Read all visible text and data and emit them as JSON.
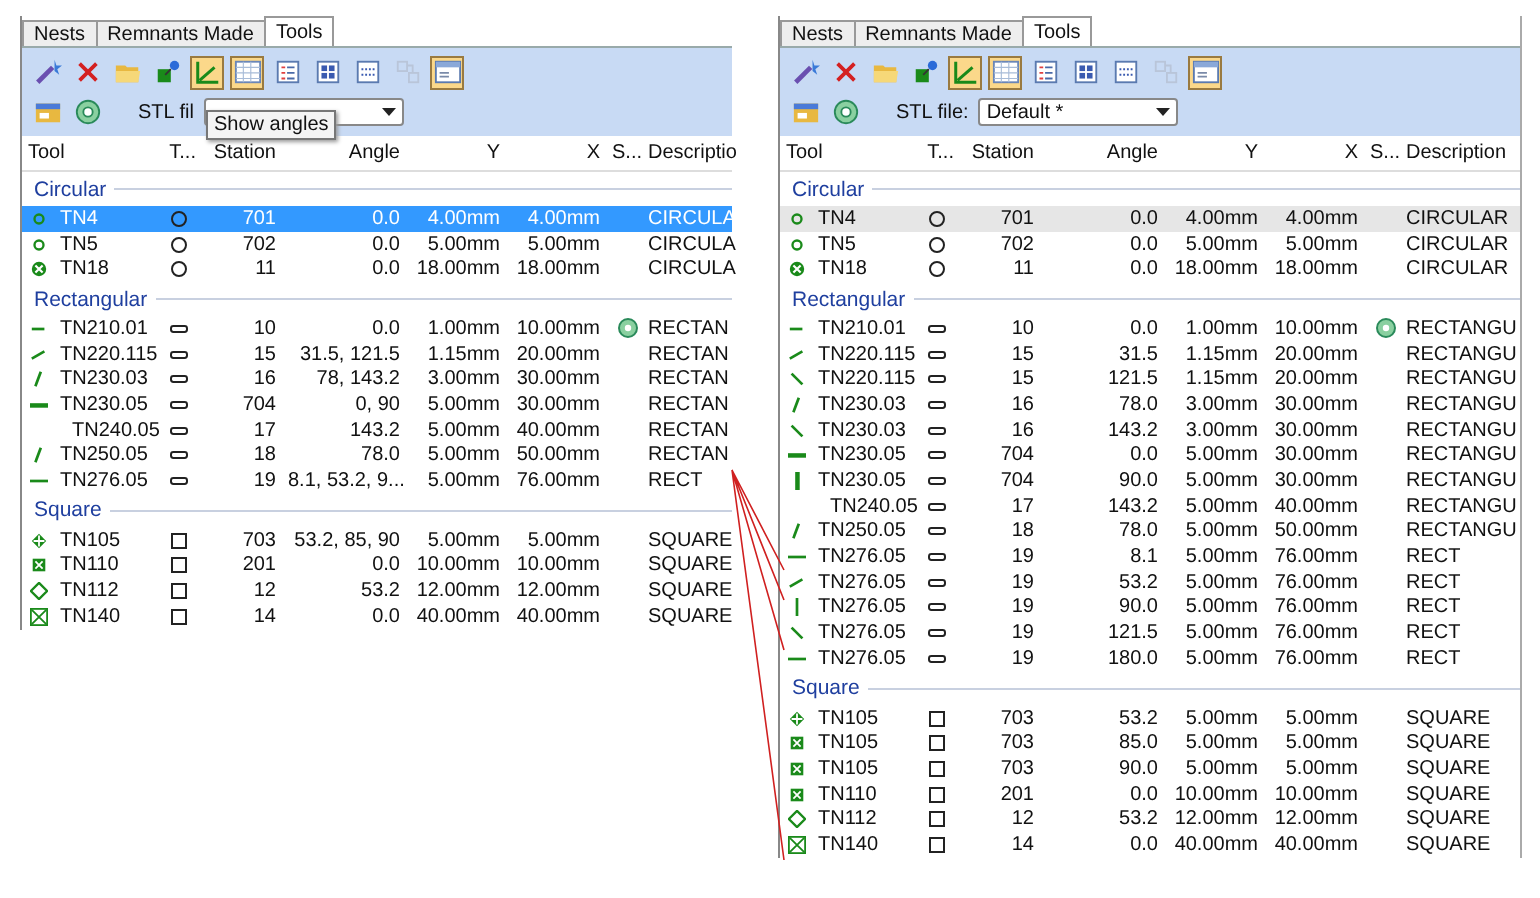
{
  "panels": [
    {
      "active": true,
      "tabs": [
        {
          "label": "Nests",
          "selected": false
        },
        {
          "label": "Remnants Made",
          "selected": false
        },
        {
          "label": "Tools",
          "selected": true
        }
      ],
      "toolbar": [
        {
          "kind": "wand",
          "pressed": false,
          "disabled": false
        },
        {
          "kind": "delete",
          "pressed": false,
          "disabled": false
        },
        {
          "kind": "folder",
          "pressed": false,
          "disabled": false
        },
        {
          "kind": "pin",
          "pressed": false,
          "disabled": false
        },
        {
          "kind": "angle",
          "pressed": true,
          "disabled": false
        },
        {
          "kind": "grid",
          "pressed": true,
          "disabled": false
        },
        {
          "kind": "list",
          "pressed": false,
          "disabled": false
        },
        {
          "kind": "tiles",
          "pressed": false,
          "disabled": false
        },
        {
          "kind": "dots",
          "pressed": false,
          "disabled": false
        },
        {
          "kind": "link",
          "pressed": false,
          "disabled": true
        },
        {
          "kind": "panel",
          "pressed": true,
          "disabled": false
        }
      ],
      "toolbar2": [
        {
          "kind": "card",
          "pressed": false,
          "disabled": false
        },
        {
          "kind": "gear",
          "pressed": false,
          "disabled": false
        }
      ],
      "stl_label": "STL fil",
      "tooltip": "Show angles",
      "columns": [
        "Tool",
        "T...",
        "Station",
        "Angle",
        "Y",
        "X",
        "S...",
        "Descriptio"
      ],
      "groups": [
        {
          "title": "Circular",
          "kind": "ring",
          "rows": [
            {
              "kind": "dot",
              "tool": "TN4",
              "station": "701",
              "angle": "0.0",
              "y": "4.00mm",
              "x": "4.00mm",
              "special": false,
              "description": "CIRCULA",
              "selected": true
            },
            {
              "kind": "dot",
              "tool": "TN5",
              "station": "702",
              "angle": "0.0",
              "y": "5.00mm",
              "x": "5.00mm",
              "special": false,
              "description": "CIRCULA",
              "selected": false
            },
            {
              "kind": "xcircle",
              "tool": "TN18",
              "station": "11",
              "angle": "0.0",
              "y": "18.00mm",
              "x": "18.00mm",
              "special": false,
              "description": "CIRCULA",
              "selected": false
            }
          ]
        },
        {
          "title": "Rectangular",
          "kind": "slot",
          "rows": [
            {
              "kind": "dash",
              "tool": "TN210.01",
              "station": "10",
              "angle": "0.0",
              "y": "1.00mm",
              "x": "10.00mm",
              "special": true,
              "description": "RECTAN",
              "selected": false
            },
            {
              "kind": "rise",
              "tool": "TN220.115",
              "station": "15",
              "angle": "31.5, 121.5",
              "y": "1.15mm",
              "x": "20.00mm",
              "special": false,
              "description": "RECTAN",
              "selected": false
            },
            {
              "kind": "steep",
              "tool": "TN230.03",
              "station": "16",
              "angle": "78, 143.2",
              "y": "3.00mm",
              "x": "30.00mm",
              "special": false,
              "description": "RECTAN",
              "selected": false
            },
            {
              "kind": "bar",
              "tool": "TN230.05",
              "station": "704",
              "angle": "0, 90",
              "y": "5.00mm",
              "x": "30.00mm",
              "special": false,
              "description": "RECTAN",
              "selected": false
            },
            {
              "kind": "none",
              "tool": "TN240.05",
              "station": "17",
              "angle": "143.2",
              "y": "5.00mm",
              "x": "40.00mm",
              "special": false,
              "description": "RECTAN",
              "selected": false
            },
            {
              "kind": "steep",
              "tool": "TN250.05",
              "station": "18",
              "angle": "78.0",
              "y": "5.00mm",
              "x": "50.00mm",
              "special": false,
              "description": "RECTAN",
              "selected": false
            },
            {
              "kind": "longdash",
              "tool": "TN276.05",
              "station": "19",
              "angle": "8.1, 53.2, 9...",
              "y": "5.00mm",
              "x": "76.00mm",
              "special": false,
              "description": "RECT",
              "selected": false
            }
          ]
        },
        {
          "title": "Square",
          "kind": "square",
          "rows": [
            {
              "kind": "plus",
              "tool": "TN105",
              "station": "703",
              "angle": "53.2, 85, 90",
              "y": "5.00mm",
              "x": "5.00mm",
              "special": false,
              "description": "SQUARE",
              "selected": false
            },
            {
              "kind": "smallx",
              "tool": "TN110",
              "station": "201",
              "angle": "0.0",
              "y": "10.00mm",
              "x": "10.00mm",
              "special": false,
              "description": "SQUARE",
              "selected": false
            },
            {
              "kind": "diamond",
              "tool": "TN112",
              "station": "12",
              "angle": "53.2",
              "y": "12.00mm",
              "x": "12.00mm",
              "special": false,
              "description": "SQUARE",
              "selected": false
            },
            {
              "kind": "boxx",
              "tool": "TN140",
              "station": "14",
              "angle": "0.0",
              "y": "40.00mm",
              "x": "40.00mm",
              "special": false,
              "description": "SQUARE",
              "selected": false
            }
          ]
        }
      ]
    },
    {
      "active": false,
      "tabs": [
        {
          "label": "Nests",
          "selected": false
        },
        {
          "label": "Remnants Made",
          "selected": false
        },
        {
          "label": "Tools",
          "selected": true
        }
      ],
      "toolbar": [
        {
          "kind": "wand",
          "pressed": false,
          "disabled": false
        },
        {
          "kind": "delete",
          "pressed": false,
          "disabled": false
        },
        {
          "kind": "folder",
          "pressed": false,
          "disabled": false
        },
        {
          "kind": "pin",
          "pressed": false,
          "disabled": false
        },
        {
          "kind": "angle",
          "pressed": true,
          "disabled": false
        },
        {
          "kind": "grid",
          "pressed": true,
          "disabled": false
        },
        {
          "kind": "list",
          "pressed": false,
          "disabled": false
        },
        {
          "kind": "tiles",
          "pressed": false,
          "disabled": false
        },
        {
          "kind": "dots",
          "pressed": false,
          "disabled": false
        },
        {
          "kind": "link",
          "pressed": false,
          "disabled": true
        },
        {
          "kind": "panel",
          "pressed": true,
          "disabled": false
        }
      ],
      "toolbar2": [
        {
          "kind": "card",
          "pressed": false,
          "disabled": false
        },
        {
          "kind": "gear",
          "pressed": false,
          "disabled": false
        }
      ],
      "stl_label": "STL file:",
      "stl_value": "Default *",
      "columns": [
        "Tool",
        "T...",
        "Station",
        "Angle",
        "Y",
        "X",
        "S...",
        "Description"
      ],
      "groups": [
        {
          "title": "Circular",
          "kind": "ring",
          "rows": [
            {
              "kind": "dot",
              "tool": "TN4",
              "station": "701",
              "angle": "0.0",
              "y": "4.00mm",
              "x": "4.00mm",
              "special": false,
              "description": "CIRCULAR",
              "selected": true
            },
            {
              "kind": "dot",
              "tool": "TN5",
              "station": "702",
              "angle": "0.0",
              "y": "5.00mm",
              "x": "5.00mm",
              "special": false,
              "description": "CIRCULAR",
              "selected": false
            },
            {
              "kind": "xcircle",
              "tool": "TN18",
              "station": "11",
              "angle": "0.0",
              "y": "18.00mm",
              "x": "18.00mm",
              "special": false,
              "description": "CIRCULAR",
              "selected": false
            }
          ]
        },
        {
          "title": "Rectangular",
          "kind": "slot",
          "rows": [
            {
              "kind": "dash",
              "tool": "TN210.01",
              "station": "10",
              "angle": "0.0",
              "y": "1.00mm",
              "x": "10.00mm",
              "special": true,
              "description": "RECTANGU",
              "selected": false
            },
            {
              "kind": "rise",
              "tool": "TN220.115",
              "station": "15",
              "angle": "31.5",
              "y": "1.15mm",
              "x": "20.00mm",
              "special": false,
              "description": "RECTANGU",
              "selected": false
            },
            {
              "kind": "fall",
              "tool": "TN220.115",
              "station": "15",
              "angle": "121.5",
              "y": "1.15mm",
              "x": "20.00mm",
              "special": false,
              "description": "RECTANGU",
              "selected": false
            },
            {
              "kind": "steep",
              "tool": "TN230.03",
              "station": "16",
              "angle": "78.0",
              "y": "3.00mm",
              "x": "30.00mm",
              "special": false,
              "description": "RECTANGU",
              "selected": false
            },
            {
              "kind": "fall",
              "tool": "TN230.03",
              "station": "16",
              "angle": "143.2",
              "y": "3.00mm",
              "x": "30.00mm",
              "special": false,
              "description": "RECTANGU",
              "selected": false
            },
            {
              "kind": "bar",
              "tool": "TN230.05",
              "station": "704",
              "angle": "0.0",
              "y": "5.00mm",
              "x": "30.00mm",
              "special": false,
              "description": "RECTANGU",
              "selected": false
            },
            {
              "kind": "vbar",
              "tool": "TN230.05",
              "station": "704",
              "angle": "90.0",
              "y": "5.00mm",
              "x": "30.00mm",
              "special": false,
              "description": "RECTANGU",
              "selected": false
            },
            {
              "kind": "none",
              "tool": "TN240.05",
              "station": "17",
              "angle": "143.2",
              "y": "5.00mm",
              "x": "40.00mm",
              "special": false,
              "description": "RECTANGU",
              "selected": false
            },
            {
              "kind": "steep",
              "tool": "TN250.05",
              "station": "18",
              "angle": "78.0",
              "y": "5.00mm",
              "x": "50.00mm",
              "special": false,
              "description": "RECTANGU",
              "selected": false
            },
            {
              "kind": "longdash",
              "tool": "TN276.05",
              "station": "19",
              "angle": "8.1",
              "y": "5.00mm",
              "x": "76.00mm",
              "special": false,
              "description": "RECT",
              "selected": false
            },
            {
              "kind": "rise",
              "tool": "TN276.05",
              "station": "19",
              "angle": "53.2",
              "y": "5.00mm",
              "x": "76.00mm",
              "special": false,
              "description": "RECT",
              "selected": false
            },
            {
              "kind": "vertical",
              "tool": "TN276.05",
              "station": "19",
              "angle": "90.0",
              "y": "5.00mm",
              "x": "76.00mm",
              "special": false,
              "description": "RECT",
              "selected": false
            },
            {
              "kind": "fall",
              "tool": "TN276.05",
              "station": "19",
              "angle": "121.5",
              "y": "5.00mm",
              "x": "76.00mm",
              "special": false,
              "description": "RECT",
              "selected": false
            },
            {
              "kind": "longdash",
              "tool": "TN276.05",
              "station": "19",
              "angle": "180.0",
              "y": "5.00mm",
              "x": "76.00mm",
              "special": false,
              "description": "RECT",
              "selected": false
            }
          ]
        },
        {
          "title": "Square",
          "kind": "square",
          "rows": [
            {
              "kind": "plus",
              "tool": "TN105",
              "station": "703",
              "angle": "53.2",
              "y": "5.00mm",
              "x": "5.00mm",
              "special": false,
              "description": "SQUARE",
              "selected": false
            },
            {
              "kind": "smallx",
              "tool": "TN105",
              "station": "703",
              "angle": "85.0",
              "y": "5.00mm",
              "x": "5.00mm",
              "special": false,
              "description": "SQUARE",
              "selected": false
            },
            {
              "kind": "smallx",
              "tool": "TN105",
              "station": "703",
              "angle": "90.0",
              "y": "5.00mm",
              "x": "5.00mm",
              "special": false,
              "description": "SQUARE",
              "selected": false
            },
            {
              "kind": "smallx",
              "tool": "TN110",
              "station": "201",
              "angle": "0.0",
              "y": "10.00mm",
              "x": "10.00mm",
              "special": false,
              "description": "SQUARE",
              "selected": false
            },
            {
              "kind": "diamond",
              "tool": "TN112",
              "station": "12",
              "angle": "53.2",
              "y": "12.00mm",
              "x": "12.00mm",
              "special": false,
              "description": "SQUARE",
              "selected": false
            },
            {
              "kind": "boxx",
              "tool": "TN140",
              "station": "14",
              "angle": "0.0",
              "y": "40.00mm",
              "x": "40.00mm",
              "special": false,
              "description": "SQUARE",
              "selected": false
            }
          ]
        }
      ]
    }
  ]
}
